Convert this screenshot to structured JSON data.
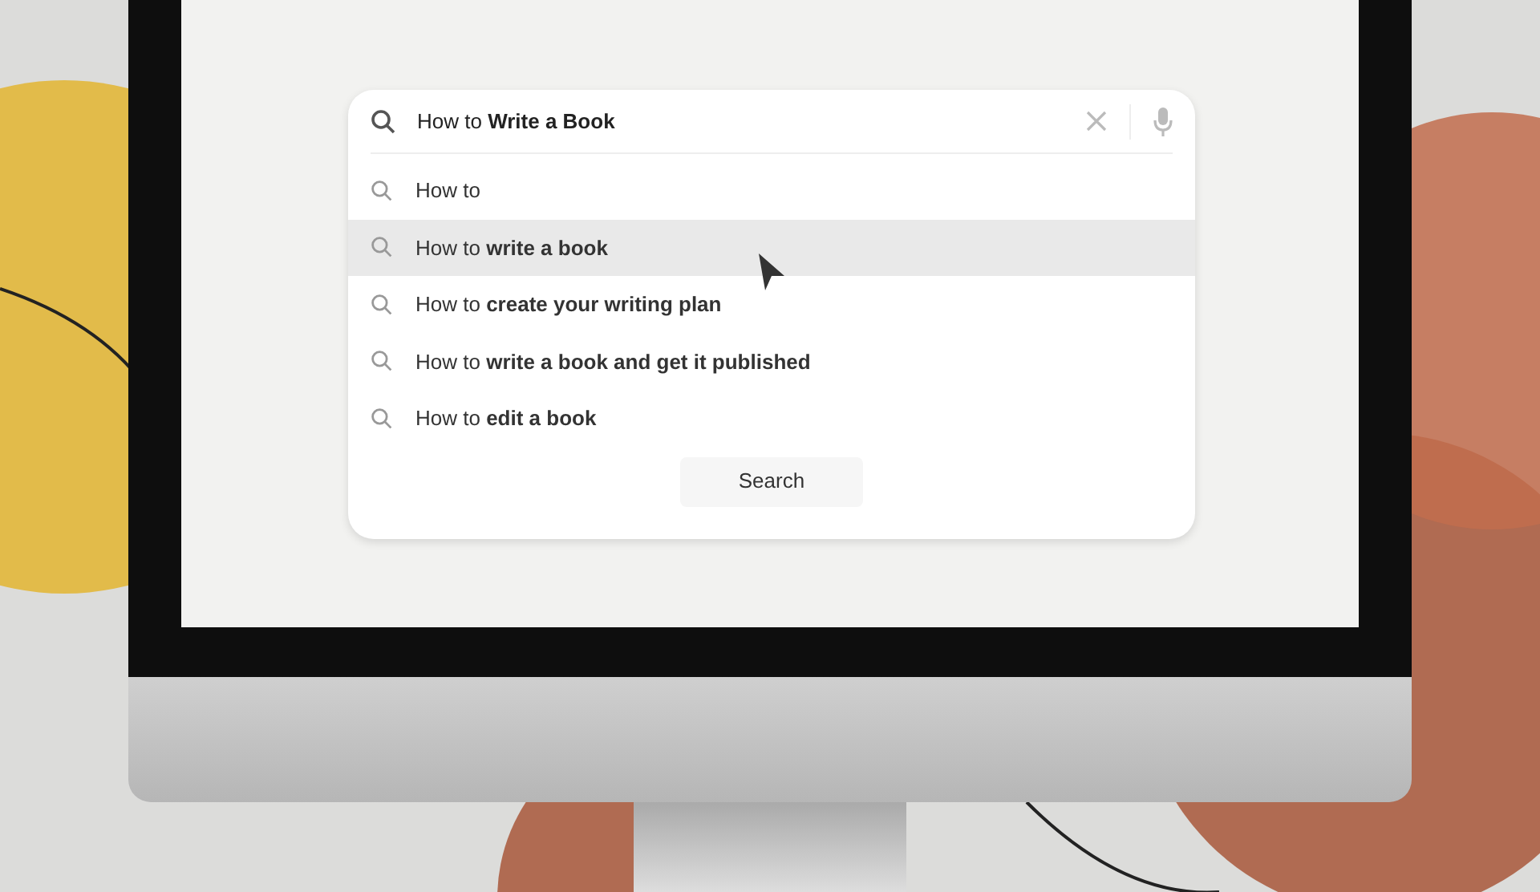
{
  "search": {
    "query": "How to **Write a Book**"
  },
  "suggestions": [
    {
      "text": "How to",
      "selected": false
    },
    {
      "text": "How to **write a book**",
      "selected": true
    },
    {
      "text": "How to **create your writing plan**",
      "selected": false
    },
    {
      "text": "How to **write a book and get it published**",
      "selected": false
    },
    {
      "text": "How to **edit a book**",
      "selected": false
    }
  ],
  "button": "Search"
}
